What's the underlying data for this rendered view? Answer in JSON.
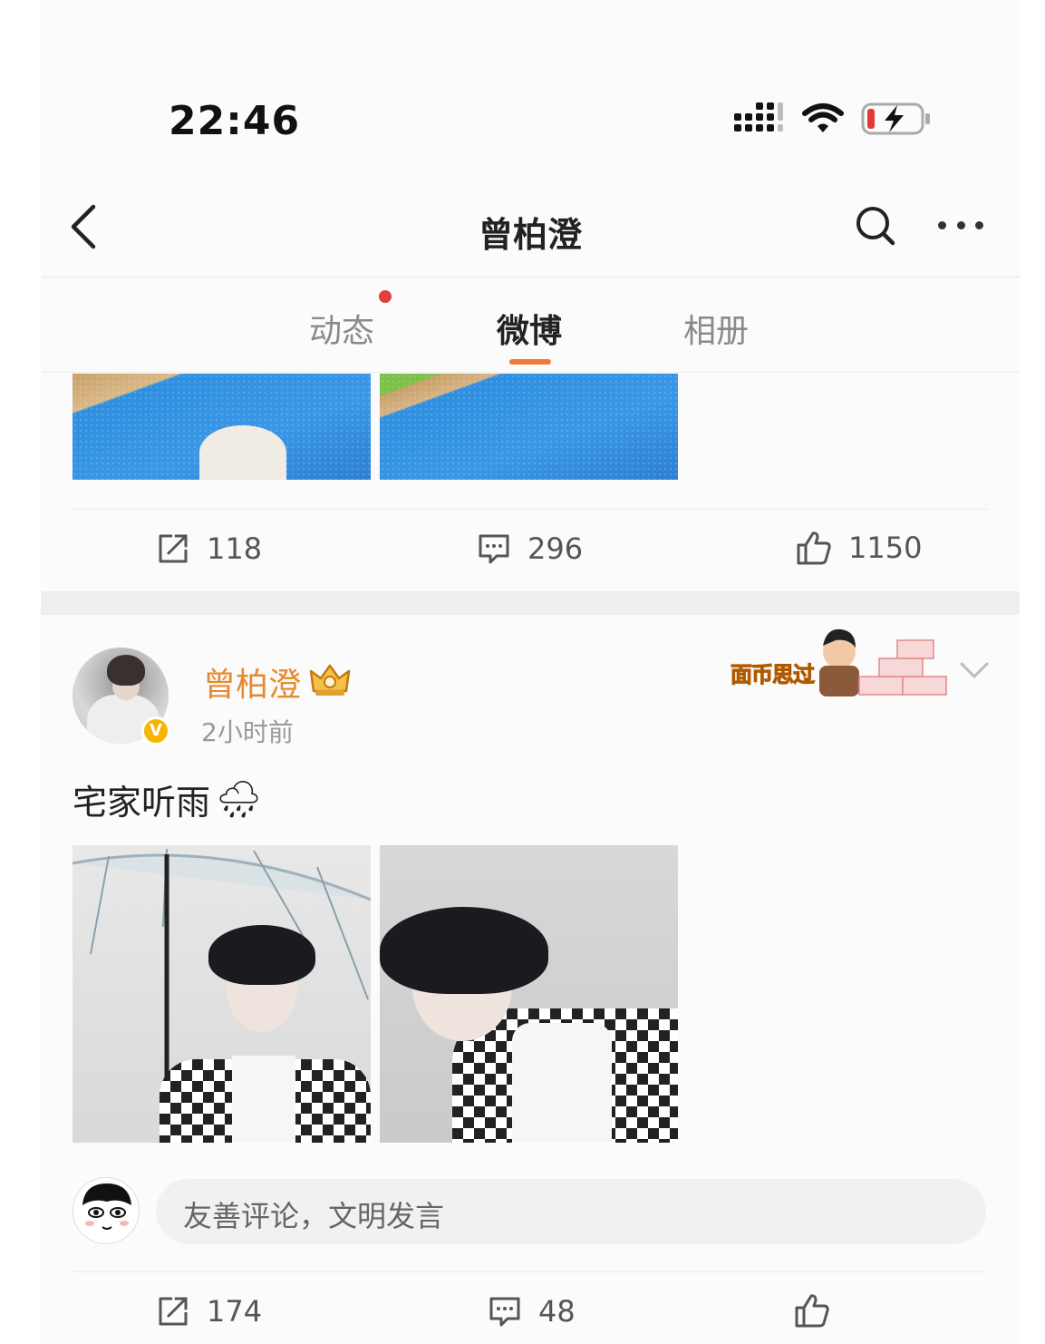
{
  "status_bar": {
    "time": "22:46",
    "icons": [
      "signal-icon",
      "wifi-icon",
      "battery-charging-icon"
    ]
  },
  "header": {
    "title": "曾柏澄",
    "icons": [
      "back-icon",
      "search-icon",
      "more-icon"
    ]
  },
  "tabs": [
    {
      "label": "动态",
      "active": false,
      "has_dot": true
    },
    {
      "label": "微博",
      "active": true,
      "has_dot": false
    },
    {
      "label": "相册",
      "active": false,
      "has_dot": false
    }
  ],
  "post1": {
    "actions": {
      "repost_count": "118",
      "comment_count": "296",
      "like_count": "1150"
    }
  },
  "post2": {
    "author": "曾柏澄",
    "time_ago": "2小时前",
    "verified_mark": "V",
    "sticker_text": "面币思过",
    "text": "宅家听雨",
    "text_emoji": "🌧",
    "comment_placeholder": "友善评论，文明发言",
    "actions": {
      "repost_count": "174",
      "comment_count": "48"
    }
  },
  "colors": {
    "accent_orange": "#f07a36",
    "username_orange": "#e68a2e",
    "notification_dot": "#e0403a",
    "verified_gold": "#f7b500"
  }
}
